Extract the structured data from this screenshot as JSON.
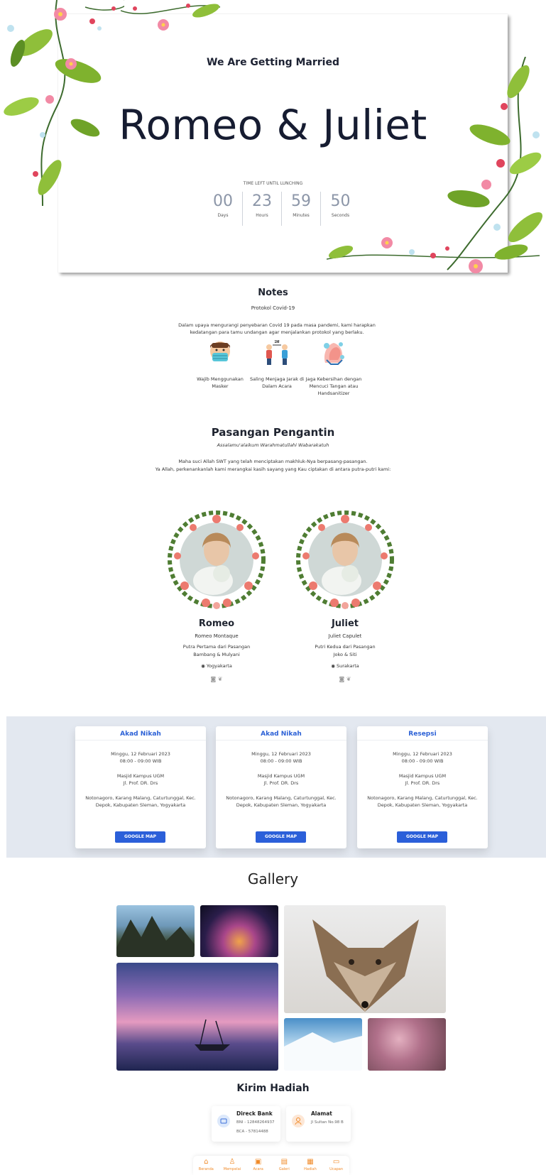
{
  "hero": {
    "subtitle": "We Are Getting Married",
    "title": "Romeo & Juliet",
    "countdown_label": "TIME LEFT UNTIL LUNCHING",
    "countdown": [
      {
        "value": "00",
        "unit": "Days"
      },
      {
        "value": "23",
        "unit": "Hours"
      },
      {
        "value": "59",
        "unit": "Minutes"
      },
      {
        "value": "50",
        "unit": "Seconds"
      }
    ]
  },
  "notes": {
    "title": "Notes",
    "subtitle": "Protokol Covid-19",
    "description": "Dalam upaya mengurangi penyebaran Covid 19 pada masa pandemi, kami harapkan kedatangan para tamu undangan agar menjalankan protokol yang berlaku.",
    "items": [
      {
        "icon": "mask-icon",
        "caption": "Wajib Menggunakan Masker"
      },
      {
        "icon": "distance-icon",
        "caption": "Saling Menjaga Jarak di Dalam Acara"
      },
      {
        "icon": "handwash-icon",
        "caption": "Jaga Kebersihan dengan Mencuci Tangan atau Handsanitizer"
      }
    ],
    "distance_label": "1M"
  },
  "couple": {
    "title": "Pasangan Pengantin",
    "greeting": "Assalamu'alaikum Warahmatullahi Wabarakatuh",
    "desc1": "Maha suci Allah SWT yang telah menciptakan makhluk-Nya berpasang-pasangan.",
    "desc2": "Ya Allah, perkenankanlah kami merangkai kasih sayang yang Kau ciptakan di antara putra-putri kami:",
    "romeo": {
      "name": "Romeo",
      "full": "Romeo Montaque",
      "desc1": "Putra Pertama dari Pasangan",
      "desc2": "Bambang & Mulyani",
      "city": "Yogyakarta"
    },
    "juliet": {
      "name": "Juliet",
      "full": "Juliet Capulet",
      "desc1": "Putri Kedua dari Pasangan",
      "desc2": "Joko & Siti",
      "city": "Surakarta"
    }
  },
  "events": [
    {
      "title": "Akad Nikah",
      "date": "Minggu, 12 Februari 2023",
      "time": "08:00 - 09:00 WIB",
      "place": "Masjid Kampus UGM",
      "street": "Jl. Prof. DR. Drs",
      "addr1": "Notonagoro, Karang Malang, Caturtunggal, Kec.",
      "addr2": "Depok, Kabupaten Sleman, Yogyakarta",
      "button": "GOOGLE MAP"
    },
    {
      "title": "Akad Nikah",
      "date": "Minggu, 12 Februari 2023",
      "time": "08:00 - 09:00 WIB",
      "place": "Masjid Kampus UGM",
      "street": "Jl. Prof. DR. Drs",
      "addr1": "Notonagoro, Karang Malang, Caturtunggal, Kec.",
      "addr2": "Depok, Kabupaten Sleman, Yogyakarta",
      "button": "GOOGLE MAP"
    },
    {
      "title": "Resepsi",
      "date": "Minggu, 12 Februari 2023",
      "time": "08:00 - 09:00 WIB",
      "place": "Masjid Kampus UGM",
      "street": "Jl. Prof. DR. Drs",
      "addr1": "Notonagoro, Karang Malang, Caturtunggal, Kec.",
      "addr2": "Depok, Kabupaten Sleman, Yogyakarta",
      "button": "GOOGLE MAP"
    }
  ],
  "gallery": {
    "title": "Gallery"
  },
  "gift": {
    "title": "Kirim Hadiah",
    "bank": {
      "title": "Direck Bank",
      "line1": "BNI - 12848264937",
      "line2": "BCA - 57814488"
    },
    "address": {
      "title": "Alamat",
      "line1": "Jl Sultan No.98 B"
    }
  },
  "nav": [
    {
      "icon": "home-icon",
      "label": "Beranda"
    },
    {
      "icon": "couple-icon",
      "label": "Mempelai"
    },
    {
      "icon": "calendar-icon",
      "label": "Acara"
    },
    {
      "icon": "gallery-icon",
      "label": "Galeri"
    },
    {
      "icon": "gift-icon",
      "label": "Hadiah"
    },
    {
      "icon": "chat-icon",
      "label": "Ucapan"
    }
  ],
  "colors": {
    "accent_blue": "#2b5fd9",
    "nav_orange": "#f08b2a",
    "band_gray": "#e3e8f0"
  }
}
